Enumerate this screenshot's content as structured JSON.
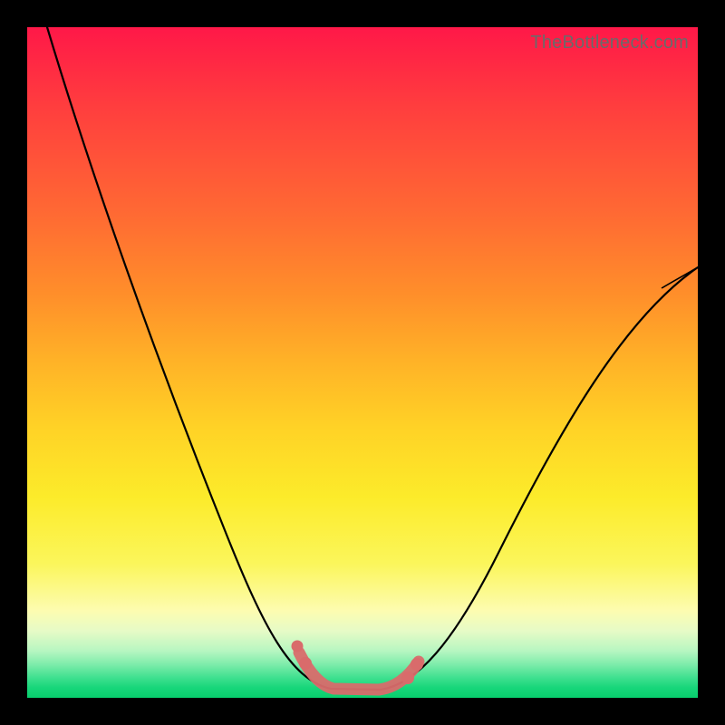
{
  "watermark": "TheBottleneck.com",
  "colors": {
    "background": "#000000",
    "curve": "#000000",
    "overlay": "#d96b6b",
    "gradient_top": "#ff1848",
    "gradient_bottom": "#08cf6d"
  },
  "chart_data": {
    "type": "line",
    "title": "",
    "xlabel": "",
    "ylabel": "",
    "xlim": [
      0,
      100
    ],
    "ylim": [
      0,
      100
    ],
    "grid": false,
    "legend": false,
    "series": [
      {
        "name": "bottleneck-curve",
        "x": [
          3,
          8,
          13,
          18,
          23,
          28,
          32,
          36,
          39,
          41,
          43,
          45,
          47,
          49,
          51,
          53,
          56,
          60,
          65,
          70,
          76,
          82,
          88,
          94,
          100
        ],
        "y": [
          100,
          88,
          76,
          64,
          53,
          42,
          33,
          25,
          18,
          13,
          8,
          4,
          2,
          1,
          1,
          2,
          5,
          10,
          17,
          25,
          34,
          43,
          51,
          58,
          64
        ]
      }
    ],
    "highlight": {
      "name": "optimal-range",
      "x_range": [
        41,
        56
      ],
      "description": "flat bottom region of curve highlighted in salmon"
    }
  }
}
